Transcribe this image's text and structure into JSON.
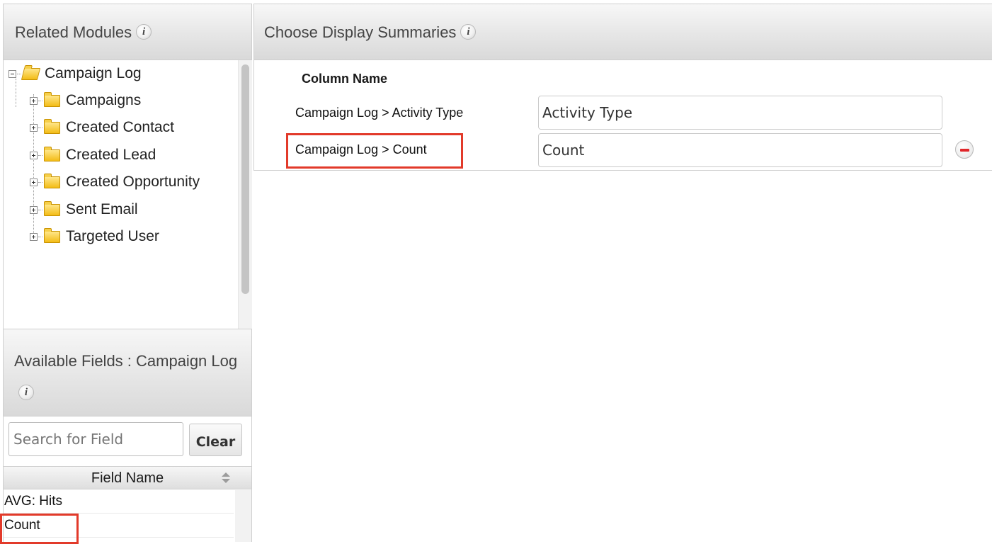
{
  "related_modules": {
    "title": "Related Modules",
    "info_icon": "i",
    "tree": {
      "root": "Campaign Log",
      "children": [
        "Campaigns",
        "Created Contact",
        "Created Lead",
        "Created Opportunity",
        "Sent Email",
        "Targeted User"
      ]
    }
  },
  "available_fields": {
    "title": "Available Fields : Campaign Log",
    "info_icon": "i",
    "search_placeholder": "Search for Field",
    "clear_label": "Clear",
    "column_header": "Field Name",
    "rows": [
      "AVG: Hits",
      "Count"
    ]
  },
  "display_summaries": {
    "title": "Choose Display Summaries",
    "info_icon": "i",
    "column_header": "Column Name",
    "rows": [
      {
        "label": "Campaign Log > Activity Type",
        "value": "Activity Type"
      },
      {
        "label": "Campaign Log > Count",
        "value": "Count"
      }
    ]
  },
  "colors": {
    "highlight": "#e23a2a",
    "remove_icon": "#e0262a",
    "folder": "#f3bc16"
  }
}
